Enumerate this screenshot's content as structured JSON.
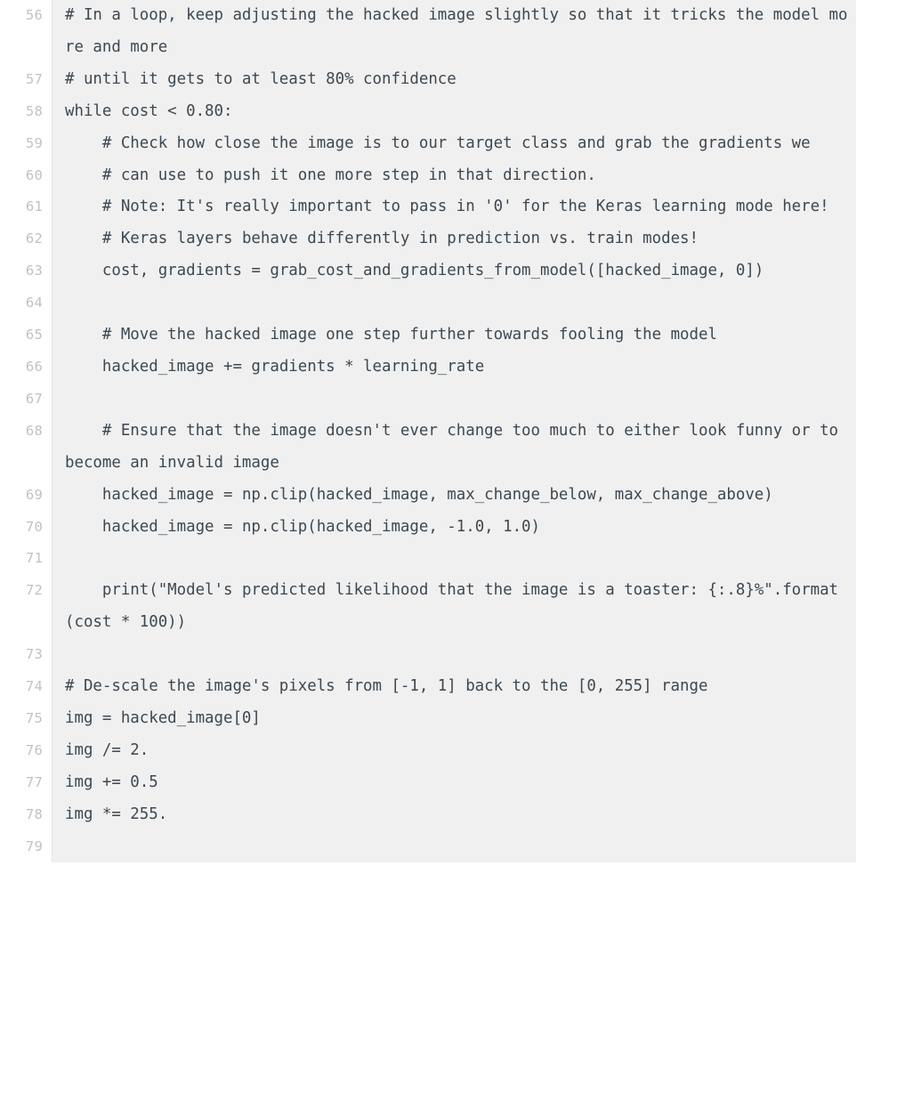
{
  "editor": {
    "language": "python",
    "first_line_number": 56,
    "last_line_number": 79,
    "wrap_enabled": true,
    "colors": {
      "page_background": "#ffffff",
      "gutter_background": "#ffffff",
      "code_background": "#f0f0f0",
      "code_text": "#3d4852",
      "line_number_text": "#bcc3c8",
      "gutter_divider": "#e2e2e2"
    }
  },
  "lines": [
    {
      "number": "56",
      "text": "# In a loop, keep adjusting the hacked image slightly so that it tricks the model more and more"
    },
    {
      "number": "57",
      "text": "# until it gets to at least 80% confidence"
    },
    {
      "number": "58",
      "text": "while cost < 0.80:"
    },
    {
      "number": "59",
      "text": "    # Check how close the image is to our target class and grab the gradients we"
    },
    {
      "number": "60",
      "text": "    # can use to push it one more step in that direction."
    },
    {
      "number": "61",
      "text": "    # Note: It's really important to pass in '0' for the Keras learning mode here!"
    },
    {
      "number": "62",
      "text": "    # Keras layers behave differently in prediction vs. train modes!"
    },
    {
      "number": "63",
      "text": "    cost, gradients = grab_cost_and_gradients_from_model([hacked_image, 0])"
    },
    {
      "number": "64",
      "text": ""
    },
    {
      "number": "65",
      "text": "    # Move the hacked image one step further towards fooling the model"
    },
    {
      "number": "66",
      "text": "    hacked_image += gradients * learning_rate"
    },
    {
      "number": "67",
      "text": ""
    },
    {
      "number": "68",
      "text": "    # Ensure that the image doesn't ever change too much to either look funny or to become an invalid image"
    },
    {
      "number": "69",
      "text": "    hacked_image = np.clip(hacked_image, max_change_below, max_change_above)"
    },
    {
      "number": "70",
      "text": "    hacked_image = np.clip(hacked_image, -1.0, 1.0)"
    },
    {
      "number": "71",
      "text": ""
    },
    {
      "number": "72",
      "text": "    print(\"Model's predicted likelihood that the image is a toaster: {:.8}%\".format(cost * 100))"
    },
    {
      "number": "73",
      "text": ""
    },
    {
      "number": "74",
      "text": "# De-scale the image's pixels from [-1, 1] back to the [0, 255] range"
    },
    {
      "number": "75",
      "text": "img = hacked_image[0]"
    },
    {
      "number": "76",
      "text": "img /= 2."
    },
    {
      "number": "77",
      "text": "img += 0.5"
    },
    {
      "number": "78",
      "text": "img *= 255."
    },
    {
      "number": "79",
      "text": ""
    }
  ]
}
